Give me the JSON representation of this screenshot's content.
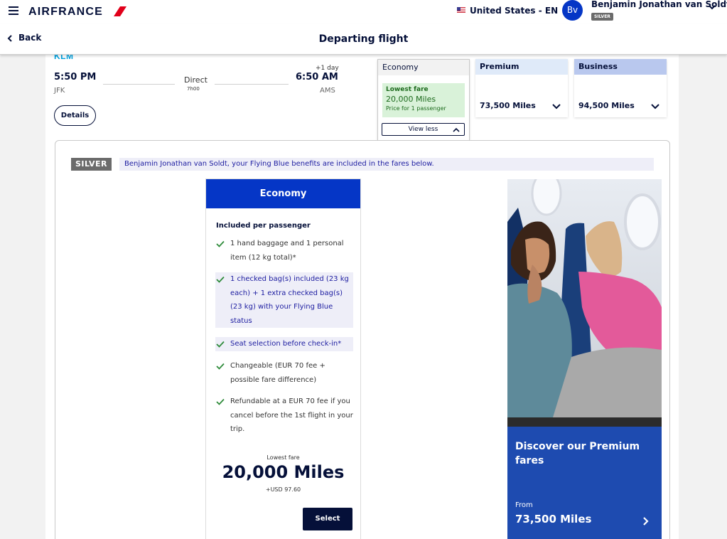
{
  "header": {
    "brand": "AIRFRANCE",
    "locale": "United States - EN",
    "avatar_initials": "Bv",
    "user_name": "Benjamin Jonathan van Soldt",
    "user_tier": "SILVER"
  },
  "subheader": {
    "back_label": "Back",
    "title": "Departing flight"
  },
  "flight": {
    "airline": "KLM",
    "departure_time": "5:50 PM",
    "departure_airport": "JFK",
    "stops": "Direct",
    "duration": "7h00",
    "day_offset": "+1 day",
    "arrival_time": "6:50 AM",
    "arrival_airport": "AMS",
    "details_label": "Details"
  },
  "cabins": {
    "economy": {
      "name": "Economy",
      "fare_label": "Lowest fare",
      "miles": "20,000 Miles",
      "price_note": "Price for 1 passenger",
      "toggle_label": "View less"
    },
    "premium": {
      "name": "Premium",
      "miles": "73,500 Miles"
    },
    "business": {
      "name": "Business",
      "miles": "94,500 Miles"
    }
  },
  "status_banner": {
    "tag": "SILVER",
    "message": "Benjamin Jonathan van Soldt, your Flying Blue benefits are included in the fares below."
  },
  "fare_card": {
    "title": "Economy",
    "included_title": "Included per passenger",
    "benefits": [
      "1 hand baggage and 1 personal item (12 kg total)*",
      "1 checked bag(s) included (23 kg each) + 1 extra checked bag(s) (23 kg) with your Flying Blue status",
      "Seat selection before check-in*",
      "Changeable (EUR 70 fee + possible fare difference)",
      "Refundable at a EUR 70 fee if you cancel before the 1st flight in your trip."
    ],
    "fare_label": "Lowest fare",
    "miles": "20,000 Miles",
    "surcharge": "+USD 97.60",
    "select_label": "Select"
  },
  "promo": {
    "title": "Discover our Premium fares",
    "from_label": "From",
    "miles": "73,500 Miles"
  },
  "colors": {
    "brand_navy": "#051039",
    "brand_red": "#e1001a",
    "economy_blue": "#0536c6",
    "promo_blue": "#1e4bb0",
    "success_green": "#1d6b1d",
    "highlight_text": "#1c1ca0"
  }
}
